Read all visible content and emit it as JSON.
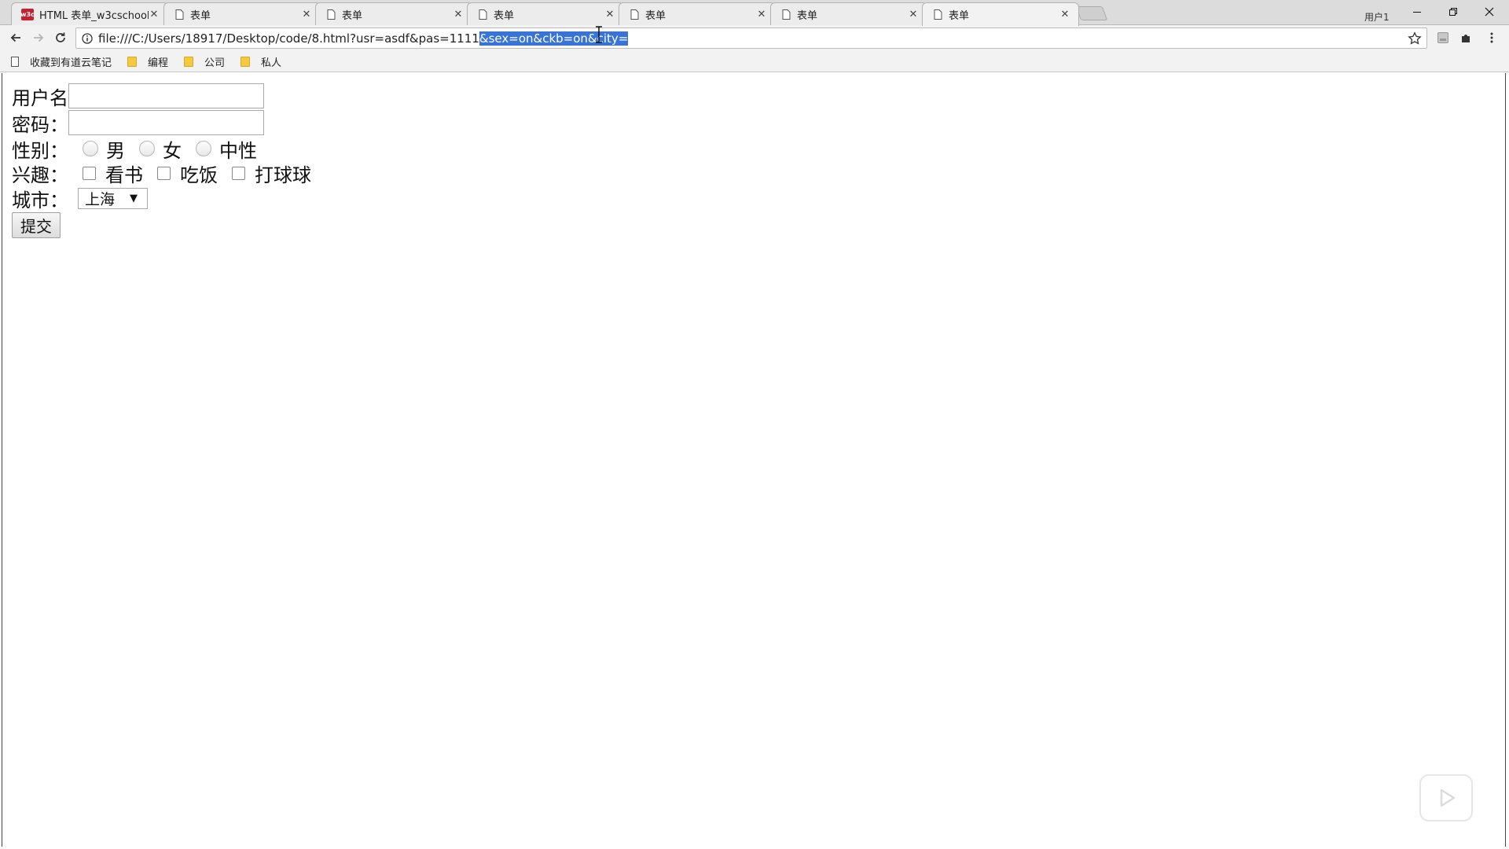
{
  "tabs": [
    {
      "title": "HTML 表单_w3cschool",
      "favicon": "w3c-icon",
      "favicon_text": "w3c"
    },
    {
      "title": "表单",
      "favicon": "page-icon"
    },
    {
      "title": "表单",
      "favicon": "page-icon"
    },
    {
      "title": "表单",
      "favicon": "page-icon"
    },
    {
      "title": "表单",
      "favicon": "page-icon"
    },
    {
      "title": "表单",
      "favicon": "page-icon"
    },
    {
      "title": "表单",
      "favicon": "page-icon",
      "active": true
    }
  ],
  "window": {
    "profile_label": "用户1"
  },
  "address_bar": {
    "url_plain": "file:///C:/Users/18917/Desktop/code/8.html?usr=asdf&pas=1111",
    "url_selected": "&sex=on&ckb=on&city="
  },
  "bookmarks": [
    {
      "label": "收藏到有道云笔记",
      "icon": "page-icon"
    },
    {
      "label": "编程",
      "icon": "folder-icon"
    },
    {
      "label": "公司",
      "icon": "folder-icon"
    },
    {
      "label": "私人",
      "icon": "folder-icon"
    }
  ],
  "form": {
    "username_label": "用户名",
    "username_value": "",
    "password_label": "密码：",
    "password_value": "",
    "gender_label": "性别：",
    "gender_options": [
      "男",
      "女",
      "中性"
    ],
    "hobby_label": "兴趣：",
    "hobby_options": [
      "看书",
      "吃饭",
      "打球球"
    ],
    "city_label": "城市：",
    "city_selected": "上海",
    "submit_label": "提交"
  },
  "colors": {
    "selection": "#3874d8",
    "w3c_brand": "#c7202e"
  }
}
